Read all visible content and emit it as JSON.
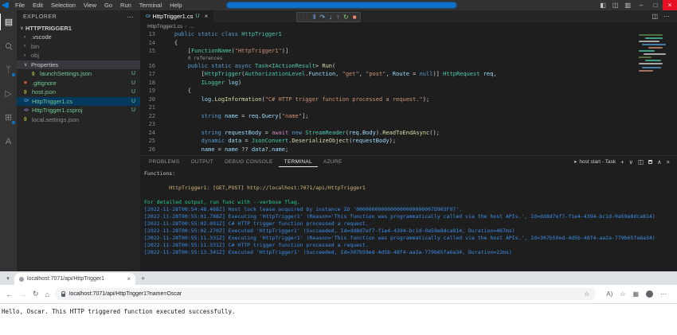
{
  "vscode": {
    "menus": [
      "File",
      "Edit",
      "Selection",
      "View",
      "Go",
      "Run",
      "Terminal",
      "Help"
    ],
    "layout_buttons": [
      {
        "name": "toggle-primary-sidebar-icon",
        "glyph": "◧"
      },
      {
        "name": "toggle-panel-icon",
        "glyph": "◫"
      },
      {
        "name": "customize-layout-icon",
        "glyph": "▥"
      }
    ],
    "window_buttons": [
      {
        "name": "minimize-button",
        "glyph": "–"
      },
      {
        "name": "restore-button",
        "glyph": "□"
      },
      {
        "name": "close-button",
        "glyph": "×",
        "style": "close"
      }
    ],
    "activity_bar": [
      {
        "name": "explorer",
        "glyph": "▤",
        "active": true
      },
      {
        "name": "search",
        "glyph": "css-search"
      },
      {
        "name": "source-control",
        "glyph": "ᛘ",
        "badge": true
      },
      {
        "name": "run-and-debug",
        "glyph": "▷"
      },
      {
        "name": "extensions",
        "glyph": "⊞",
        "badge": true
      },
      {
        "name": "azure",
        "glyph": "A"
      }
    ],
    "debug_toolbar": [
      {
        "name": "pause-icon",
        "glyph": "‖",
        "color": "#75beff"
      },
      {
        "name": "step-over-icon",
        "glyph": "↷",
        "color": "#75beff"
      },
      {
        "name": "step-into-icon",
        "glyph": "↓",
        "color": "#75beff"
      },
      {
        "name": "step-out-icon",
        "glyph": "↑",
        "color": "#75beff"
      },
      {
        "name": "restart-icon",
        "glyph": "↻",
        "color": "#89d185"
      },
      {
        "name": "stop-icon",
        "glyph": "■",
        "color": "#f48771"
      }
    ]
  },
  "explorer": {
    "title": "EXPLORER",
    "more_icon": "⋯",
    "root": "HTTPTRIGGER1",
    "root_chevron": "∨",
    "file_icons": {
      "json": {
        "glyph": "{}",
        "color": "#cbcb41"
      },
      "cs": {
        "glyph": "C#",
        "color": "#519aba"
      },
      "csproj": {
        "glyph": "</>",
        "color": "#a074c4"
      },
      "git": {
        "glyph": "◆",
        "color": "#e0583e"
      }
    },
    "items": [
      {
        "label": ".vscode",
        "kind": "folder",
        "indent": 0
      },
      {
        "label": "bin",
        "kind": "folder",
        "indent": 0,
        "dim": true
      },
      {
        "label": "obj",
        "kind": "folder",
        "indent": 0,
        "dim": true
      },
      {
        "label": "Properties",
        "kind": "folder",
        "indent": 0,
        "expanded": true,
        "focused": true
      },
      {
        "label": "launchSettings.json",
        "kind": "json",
        "indent": 1,
        "git": "U"
      },
      {
        "label": ".gitignore",
        "kind": "git",
        "indent": 0,
        "git": "U"
      },
      {
        "label": "host.json",
        "kind": "json",
        "indent": 0,
        "git": "U"
      },
      {
        "label": "HttpTrigger1.cs",
        "kind": "cs",
        "indent": 0,
        "git": "U",
        "selected": true
      },
      {
        "label": "HttpTrigger1.csproj",
        "kind": "csproj",
        "indent": 0,
        "git": "U"
      },
      {
        "label": "local.settings.json",
        "kind": "json",
        "indent": 0,
        "dim": true
      }
    ]
  },
  "editor": {
    "tab": {
      "icon": "C#",
      "label": "HttpTrigger1.cs",
      "git": "U",
      "close": "×"
    },
    "split_icon": "◫",
    "more_icon": "⋯",
    "breadcrumbs": [
      "HttpTrigger1.cs",
      "…"
    ],
    "codelens": "0 references",
    "lines": [
      {
        "n": "13",
        "tk": [
          [
            "p",
            "    "
          ],
          [
            "k",
            "public"
          ],
          [
            "p",
            " "
          ],
          [
            "k",
            "static"
          ],
          [
            "p",
            " "
          ],
          [
            "k",
            "class"
          ],
          [
            "p",
            " "
          ],
          [
            "t",
            "HttpTrigger1"
          ]
        ]
      },
      {
        "n": "14",
        "tk": [
          [
            "p",
            "    {"
          ]
        ]
      },
      {
        "n": "15",
        "tk": [
          [
            "p",
            "        ["
          ],
          [
            "t",
            "FunctionName"
          ],
          [
            "p",
            "("
          ],
          [
            "s",
            "\"HttpTrigger1\""
          ],
          [
            "p",
            ")]"
          ]
        ]
      },
      {
        "lens": true
      },
      {
        "n": "16",
        "tk": [
          [
            "p",
            "        "
          ],
          [
            "k",
            "public"
          ],
          [
            "p",
            " "
          ],
          [
            "k",
            "static"
          ],
          [
            "p",
            " "
          ],
          [
            "k",
            "async"
          ],
          [
            "p",
            " "
          ],
          [
            "t",
            "Task"
          ],
          [
            "p",
            "<"
          ],
          [
            "t",
            "IActionResult"
          ],
          [
            "p",
            "> "
          ],
          [
            "f",
            "Run"
          ],
          [
            "p",
            "("
          ]
        ]
      },
      {
        "n": "17",
        "tk": [
          [
            "p",
            "            ["
          ],
          [
            "t",
            "HttpTrigger"
          ],
          [
            "p",
            "("
          ],
          [
            "t",
            "AuthorizationLevel"
          ],
          [
            "p",
            "."
          ],
          [
            "v",
            "Function"
          ],
          [
            "p",
            ", "
          ],
          [
            "s",
            "\"get\""
          ],
          [
            "p",
            ", "
          ],
          [
            "s",
            "\"post\""
          ],
          [
            "p",
            ", "
          ],
          [
            "v",
            "Route"
          ],
          [
            "p",
            " = "
          ],
          [
            "k",
            "null"
          ],
          [
            "p",
            ")] "
          ],
          [
            "t",
            "HttpRequest"
          ],
          [
            "p",
            " "
          ],
          [
            "v",
            "req"
          ],
          [
            "p",
            ","
          ]
        ]
      },
      {
        "n": "18",
        "tk": [
          [
            "p",
            "            "
          ],
          [
            "t",
            "ILogger"
          ],
          [
            "p",
            " "
          ],
          [
            "v",
            "log"
          ],
          [
            "p",
            ")"
          ]
        ]
      },
      {
        "n": "19",
        "tk": [
          [
            "p",
            "        {"
          ]
        ]
      },
      {
        "n": "20",
        "tk": [
          [
            "p",
            "            "
          ],
          [
            "v",
            "log"
          ],
          [
            "p",
            "."
          ],
          [
            "f",
            "LogInformation"
          ],
          [
            "p",
            "("
          ],
          [
            "s",
            "\"C# HTTP trigger function processed a request.\""
          ],
          [
            "p",
            ");"
          ]
        ]
      },
      {
        "n": "21",
        "tk": []
      },
      {
        "n": "22",
        "tk": [
          [
            "p",
            "            "
          ],
          [
            "k",
            "string"
          ],
          [
            "p",
            " "
          ],
          [
            "v",
            "name"
          ],
          [
            "p",
            " = "
          ],
          [
            "v",
            "req"
          ],
          [
            "p",
            "."
          ],
          [
            "v",
            "Query"
          ],
          [
            "p",
            "["
          ],
          [
            "s",
            "\"name\""
          ],
          [
            "p",
            "];"
          ]
        ]
      },
      {
        "n": "23",
        "tk": []
      },
      {
        "n": "24",
        "tk": [
          [
            "p",
            "            "
          ],
          [
            "k",
            "string"
          ],
          [
            "p",
            " "
          ],
          [
            "v",
            "requestBody"
          ],
          [
            "p",
            " = "
          ],
          [
            "c",
            "await"
          ],
          [
            "p",
            " "
          ],
          [
            "k",
            "new"
          ],
          [
            "p",
            " "
          ],
          [
            "t",
            "StreamReader"
          ],
          [
            "p",
            "("
          ],
          [
            "v",
            "req"
          ],
          [
            "p",
            "."
          ],
          [
            "v",
            "Body"
          ],
          [
            "p",
            ")."
          ],
          [
            "f",
            "ReadToEndAsync"
          ],
          [
            "p",
            "();"
          ]
        ]
      },
      {
        "n": "25",
        "tk": [
          [
            "p",
            "            "
          ],
          [
            "k",
            "dynamic"
          ],
          [
            "p",
            " "
          ],
          [
            "v",
            "data"
          ],
          [
            "p",
            " = "
          ],
          [
            "t",
            "JsonConvert"
          ],
          [
            "p",
            "."
          ],
          [
            "f",
            "DeserializeObject"
          ],
          [
            "p",
            "("
          ],
          [
            "v",
            "requestBody"
          ],
          [
            "p",
            ");"
          ]
        ]
      },
      {
        "n": "26",
        "tk": [
          [
            "p",
            "            "
          ],
          [
            "v",
            "name"
          ],
          [
            "p",
            " = "
          ],
          [
            "v",
            "name"
          ],
          [
            "p",
            " ?? "
          ],
          [
            "v",
            "data"
          ],
          [
            "p",
            "?."
          ],
          [
            "v",
            "name"
          ],
          [
            "p",
            ";"
          ]
        ]
      }
    ]
  },
  "panel": {
    "tabs": [
      {
        "label": "PROBLEMS"
      },
      {
        "label": "OUTPUT"
      },
      {
        "label": "DEBUG CONSOLE"
      },
      {
        "label": "TERMINAL",
        "active": true
      },
      {
        "label": "AZURE"
      }
    ],
    "task_icon": "▸",
    "task_label": "host start - Task",
    "actions": [
      {
        "name": "new-terminal-icon",
        "glyph": "+"
      },
      {
        "name": "launch-profile-chevron-icon",
        "glyph": "∨"
      },
      {
        "name": "split-terminal-icon",
        "glyph": "◫"
      },
      {
        "name": "kill-terminal-icon",
        "glyph": "css-trash"
      },
      {
        "name": "maximize-panel-icon",
        "glyph": "∧"
      },
      {
        "name": "close-panel-icon",
        "glyph": "×"
      }
    ],
    "terminal_lines": [
      {
        "c": "white",
        "text": "Functions:"
      },
      {
        "c": "white",
        "text": ""
      },
      {
        "c": "yellow",
        "text": "        HttpTrigger1: [GET,POST] http://localhost:7071/api/HttpTrigger1"
      },
      {
        "c": "white",
        "text": ""
      },
      {
        "c": "green",
        "text": "For detailed output, run func with --verbose flag."
      },
      {
        "c": "blue",
        "text": "[2022-11-28T00:54:48.468Z] Host lock lease acquired by instance ID '0000000000000000000000007D903F97'."
      },
      {
        "c": "blue",
        "text": "[2022-11-28T00:55:01.788Z] Executing 'HttpTrigger1' (Reason='This function was programmatically called via the host APIs.', Id=dd8d7ef7-f1e4-4394-bc1d-0a59e8dca814)"
      },
      {
        "c": "blue",
        "text": "[2022-11-28T00:55:02.091Z] C# HTTP trigger function processed a request."
      },
      {
        "c": "blue",
        "text": "[2022-11-28T00:55:02.270Z] Executed 'HttpTrigger1' (Succeeded, Id=dd8d7ef7-f1e4-4394-bc1d-0a59e8dca814, Duration=467ms)"
      },
      {
        "c": "blue",
        "text": "[2022-11-28T00:55:11.331Z] Executing 'HttpTrigger1' (Reason='This function was programmatically called via the host APIs.', Id=307b59ed-4d5b-48f4-aa2a-779b65fa6a34)"
      },
      {
        "c": "blue",
        "text": "[2022-11-28T00:55:11.331Z] C# HTTP trigger function processed a request."
      },
      {
        "c": "blue",
        "text": "[2022-11-28T00:55:13.341Z] Executed 'HttpTrigger1' (Succeeded, Id=307b59ed-4d5b-48f4-aa2a-779b65fa6a34, Duration=22ms)"
      }
    ]
  },
  "browser": {
    "tab_actions_icon": "▾",
    "tab": {
      "title": "localhost:7071/api/HttpTrigger1",
      "close": "×"
    },
    "new_tab_icon": "+",
    "nav": [
      {
        "name": "back-icon",
        "glyph": "←"
      },
      {
        "name": "forward-icon",
        "glyph": "→",
        "disabled": true
      },
      {
        "name": "refresh-icon",
        "glyph": "↻"
      },
      {
        "name": "home-icon",
        "glyph": "⌂"
      }
    ],
    "url": "localhost:7071/api/HttpTrigger1?name=Oscar",
    "pill_star": "☆",
    "right_icons": [
      {
        "name": "read-aloud-icon",
        "glyph": "A)"
      },
      {
        "name": "favorites-icon",
        "glyph": "☆"
      },
      {
        "name": "collections-icon",
        "glyph": "▦"
      },
      {
        "name": "profile-icon",
        "glyph": "avatar"
      },
      {
        "name": "browser-more-icon",
        "glyph": "⋯"
      }
    ],
    "page_text": "Hello, Oscar. This HTTP triggered function executed successfully."
  }
}
